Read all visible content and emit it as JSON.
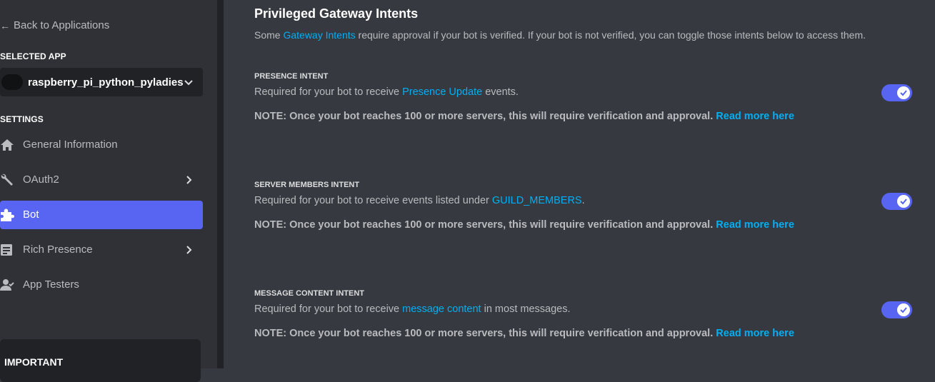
{
  "sidebar": {
    "back_label": "Back to Applications",
    "selected_app_label": "SELECTED APP",
    "selected_app_name": "raspberry_pi_python_pyladies",
    "settings_label": "SETTINGS",
    "items": [
      {
        "label": "General Information",
        "icon": "home-icon",
        "has_chevron": false,
        "active": false
      },
      {
        "label": "OAuth2",
        "icon": "wrench-icon",
        "has_chevron": true,
        "active": false
      },
      {
        "label": "Bot",
        "icon": "puzzle-icon",
        "has_chevron": false,
        "active": true
      },
      {
        "label": "Rich Presence",
        "icon": "document-icon",
        "has_chevron": true,
        "active": false
      },
      {
        "label": "App Testers",
        "icon": "person-icon",
        "has_chevron": false,
        "active": false
      }
    ],
    "important_label": "IMPORTANT"
  },
  "main": {
    "heading": "Privileged Gateway Intents",
    "desc_pre": "Some ",
    "desc_link": "Gateway Intents",
    "desc_post": " require approval if your bot is verified. If your bot is not verified, you can toggle those intents below to access them.",
    "intents": [
      {
        "title": "PRESENCE INTENT",
        "desc_pre": "Required for your bot to receive ",
        "desc_link": "Presence Update",
        "desc_post": " events.",
        "note": "NOTE: Once your bot reaches 100 or more servers, this will require verification and approval.",
        "note_link": "Read more here",
        "enabled": true
      },
      {
        "title": "SERVER MEMBERS INTENT",
        "desc_pre": "Required for your bot to receive events listed under ",
        "desc_link": "GUILD_MEMBERS",
        "desc_post": ".",
        "note": "NOTE: Once your bot reaches 100 or more servers, this will require verification and approval.",
        "note_link": "Read more here",
        "enabled": true
      },
      {
        "title": "MESSAGE CONTENT INTENT",
        "desc_pre": "Required for your bot to receive ",
        "desc_link": "message content",
        "desc_post": " in most messages.",
        "note": "NOTE: Once your bot reaches 100 or more servers, this will require verification and approval.",
        "note_link": "Read more here",
        "enabled": true
      }
    ]
  },
  "colors": {
    "accent": "#5865f2",
    "link": "#00aff4",
    "sidebar_bg": "#2f3136",
    "main_bg": "#36393f"
  }
}
